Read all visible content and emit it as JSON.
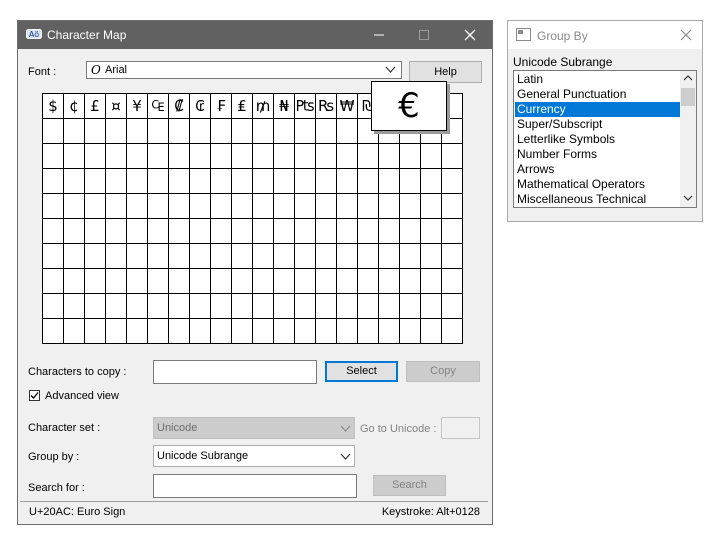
{
  "char_map": {
    "title": "Character Map",
    "window_controls": {
      "minimize": "—",
      "maximize": "☐",
      "close": "✕"
    },
    "font_label": "Font :",
    "font_icon_glyph": "O",
    "font_value": "Arial",
    "help_label": "Help",
    "grid_characters": [
      "$",
      "¢",
      "£",
      "¤",
      "¥",
      "₠",
      "₡",
      "₢",
      "₣",
      "₤",
      "₥",
      "₦",
      "₧",
      "₨",
      "₩",
      "₪"
    ],
    "magnified_char": "€",
    "copy_label": "Characters to copy :",
    "copy_value": "",
    "select_label": "Select",
    "copy_button_label": "Copy",
    "advanced_view_label": "Advanced view",
    "advanced_view_checked": true,
    "charset_label": "Character set :",
    "charset_value": "Unicode",
    "goto_label": "Go to Unicode :",
    "goto_value": "",
    "groupby_label": "Group by :",
    "groupby_value": "Unicode Subrange",
    "search_label": "Search for :",
    "search_value": "",
    "search_button_label": "Search",
    "status_left": "U+20AC: Euro Sign",
    "status_right": "Keystroke: Alt+0128"
  },
  "group_by": {
    "title": "Group By",
    "close": "✕",
    "header": "Unicode Subrange",
    "items": [
      "Latin",
      "General Punctuation",
      "Currency",
      "Super/Subscript",
      "Letterlike Symbols",
      "Number Forms",
      "Arrows",
      "Mathematical Operators",
      "Miscellaneous Technical"
    ],
    "selected_index": 2
  },
  "colors": {
    "titlebar_active": "#616161",
    "selection": "#0078d7"
  }
}
